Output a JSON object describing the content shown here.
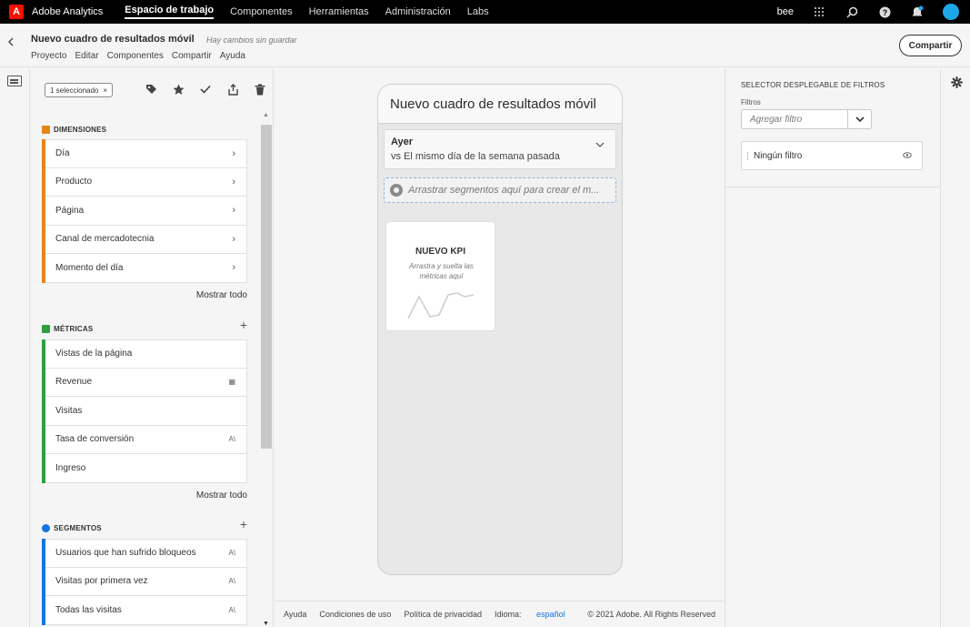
{
  "topnav": {
    "brand": "Adobe Analytics",
    "items": [
      {
        "label": "Espacio de trabajo",
        "active": true
      },
      {
        "label": "Componentes",
        "active": false
      },
      {
        "label": "Herramientas",
        "active": false
      },
      {
        "label": "Administración",
        "active": false
      },
      {
        "label": "Labs",
        "active": false
      }
    ],
    "user": "bee",
    "icons": [
      "apps-grid-icon",
      "search-icon",
      "help-icon",
      "notifications-bell-icon",
      "user-avatar"
    ]
  },
  "project": {
    "title": "Nuevo cuadro de resultados móvil",
    "unsaved": "Hay cambios sin guardar",
    "menu": [
      "Proyecto",
      "Editar",
      "Componentes",
      "Compartir",
      "Ayuda"
    ],
    "share_button": "Compartir"
  },
  "components": {
    "selected_badge": "1 seleccionado",
    "toolbar_icons": [
      "tag-icon",
      "star-icon",
      "check-icon",
      "share-icon",
      "trash-icon"
    ],
    "dimensions": {
      "title": "DIMENSIONES",
      "color": "#e68619",
      "items": [
        "Día",
        "Producto",
        "Página",
        "Canal de mercadotecnia",
        "Momento del día"
      ],
      "show_all": "Mostrar todo"
    },
    "metrics": {
      "title": "MÉTRICAS",
      "color": "#2da140",
      "items": [
        {
          "label": "Vistas de la página",
          "badge": ""
        },
        {
          "label": "Revenue",
          "badge": "calculator-icon"
        },
        {
          "label": "Visitas",
          "badge": ""
        },
        {
          "label": "Tasa de conversión",
          "badge": "adobe-icon"
        },
        {
          "label": "Ingreso",
          "badge": ""
        }
      ],
      "show_all": "Mostrar todo"
    },
    "segments": {
      "title": "SEGMENTOS",
      "color": "#1473e6",
      "items": [
        {
          "label": "Usuarios que han sufrido bloqueos",
          "badge": "adobe-icon"
        },
        {
          "label": "Visitas por primera vez",
          "badge": "adobe-icon"
        },
        {
          "label": "Todas las visitas",
          "badge": "adobe-icon"
        }
      ]
    }
  },
  "scorecard": {
    "title": "Nuevo cuadro de resultados móvil",
    "date_main": "Ayer",
    "date_compare": "vs El mismo día de la semana pasada",
    "drop_zone": "Arrastrar segmentos aquí para crear el m...",
    "kpi": {
      "title": "NUEVO KPI",
      "subtitle": "Arrastra y suelta las métricas aquí"
    }
  },
  "footer": {
    "help": "Ayuda",
    "terms": "Condiciones de uso",
    "privacy": "Política de privacidad",
    "language_label": "Idioma:",
    "language_value": "español",
    "copyright": "© 2021 Adobe. All Rights Reserved"
  },
  "filters_panel": {
    "title": "SELECTOR DESPLEGABLE DE FILTROS",
    "label": "Filtros",
    "placeholder": "Agregar filtro",
    "filter_item": "Ningún filtro"
  }
}
